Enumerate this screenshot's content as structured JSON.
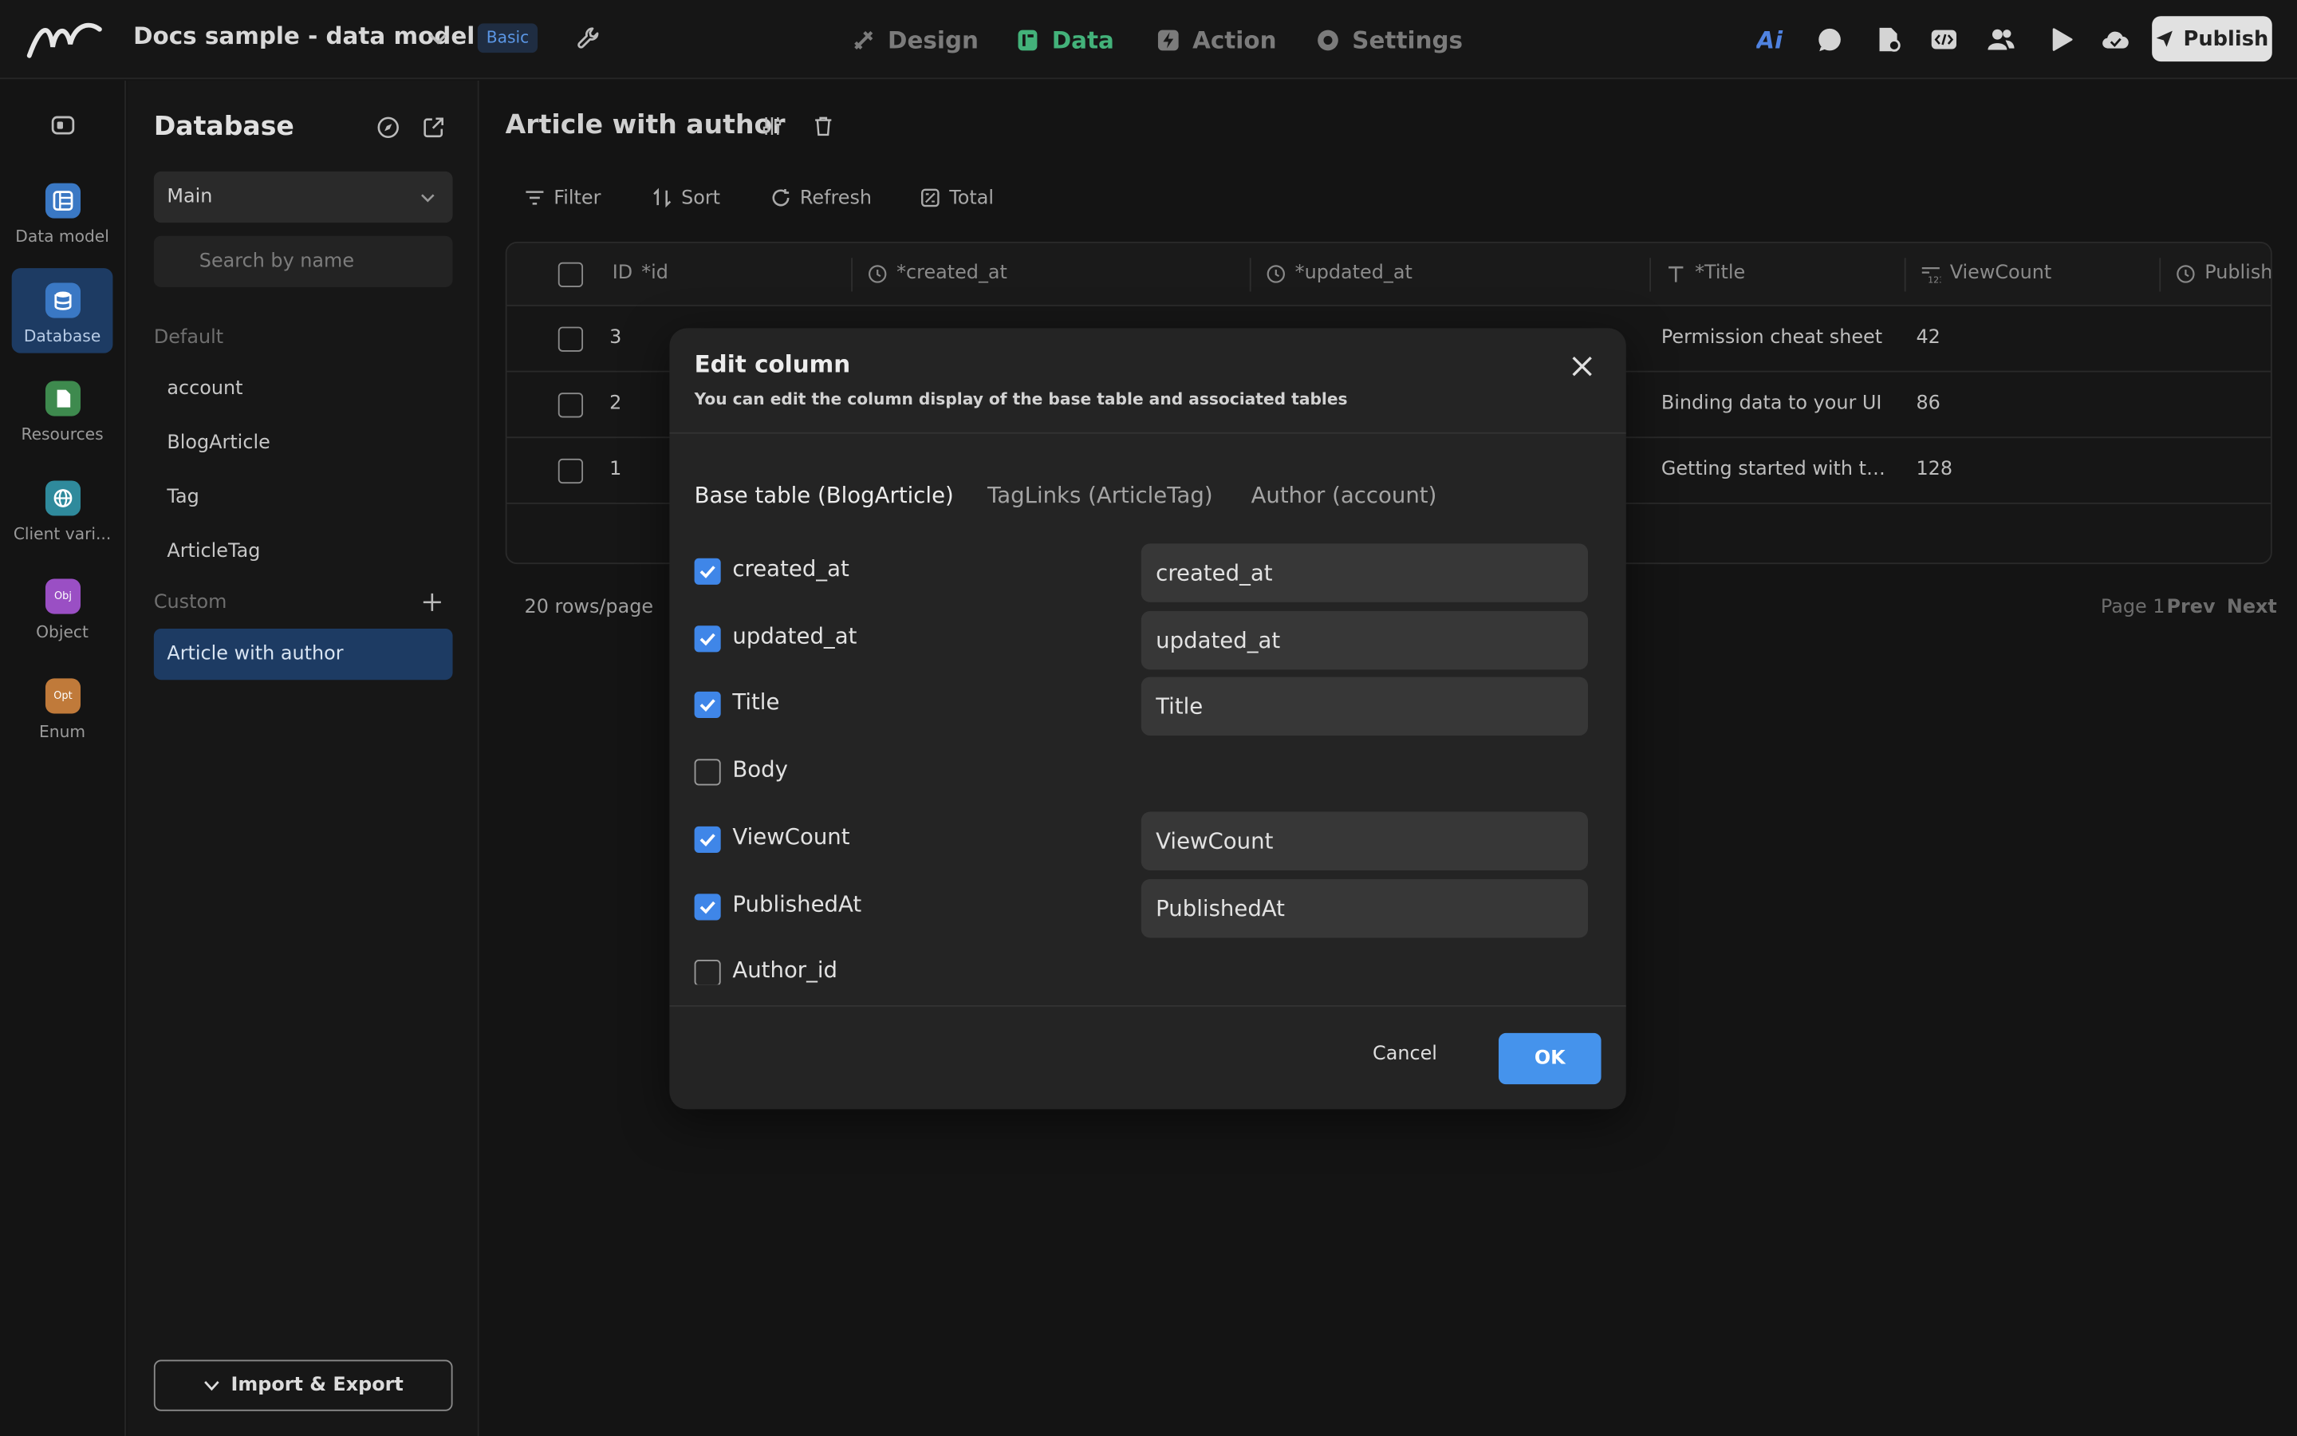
{
  "app": {
    "title": "Docs sample - data model",
    "plan_badge": "Basic",
    "nav_tabs": [
      {
        "label": "Design",
        "active": false
      },
      {
        "label": "Data",
        "active": true
      },
      {
        "label": "Action",
        "active": false
      },
      {
        "label": "Settings",
        "active": false
      }
    ],
    "right_icons": [
      "ai-icon",
      "chat-icon",
      "file-icon",
      "code-icon",
      "users-icon",
      "play-icon",
      "cloud-icon"
    ],
    "publish_label": "Publish",
    "colors": {
      "accent": "#4593ec",
      "data_tab": "#43b27a",
      "selected_bg": "#1d3b63"
    }
  },
  "rail": {
    "items": [
      {
        "label": "Data model",
        "icon": "data-model-icon",
        "color": "#3a78c4",
        "active": false
      },
      {
        "label": "Database",
        "icon": "database-icon",
        "color": "#3a78c4",
        "active": true
      },
      {
        "label": "Resources",
        "icon": "resources-icon",
        "color": "#3e8a4e",
        "active": false
      },
      {
        "label": "Client vari...",
        "icon": "globe-icon",
        "color": "#2f8a9c",
        "active": false
      },
      {
        "label": "Object",
        "icon": "object-icon",
        "color": "#9a4fc4",
        "glyph": "Obj",
        "active": false
      },
      {
        "label": "Enum",
        "icon": "enum-icon",
        "color": "#c07a3a",
        "glyph": "Opt",
        "active": false
      }
    ]
  },
  "database_panel": {
    "title": "Database",
    "branch": "Main",
    "search_placeholder": "Search by name",
    "default_section": "Default",
    "default_items": [
      "account",
      "BlogArticle",
      "Tag",
      "ArticleTag"
    ],
    "custom_section": "Custom",
    "custom_items": [
      "Article with author"
    ],
    "import_export_label": "Import & Export"
  },
  "main": {
    "title": "Article with author",
    "toolbar": {
      "filter": "Filter",
      "sort": "Sort",
      "refresh": "Refresh",
      "total": "Total"
    },
    "columns": [
      {
        "label": "ID",
        "req": "*id"
      },
      {
        "label": "*created_at"
      },
      {
        "label": "*updated_at"
      },
      {
        "label": "*Title"
      },
      {
        "label": "ViewCount"
      },
      {
        "label": "Publish"
      }
    ],
    "rows": [
      {
        "id": "3",
        "title": "Permission cheat sheet",
        "views": "42"
      },
      {
        "id": "2",
        "title": "Binding data to your UI",
        "views": "86"
      },
      {
        "id": "1",
        "title": "Getting started with the ...",
        "views": "128"
      }
    ],
    "page_size": "20 rows/page",
    "page_label": "Page 1",
    "prev": "Prev",
    "next": "Next"
  },
  "modal": {
    "title": "Edit column",
    "subtitle": "You can edit the column display of the base table and associated tables",
    "tabs": [
      {
        "label": "Base table (BlogArticle)",
        "active": true
      },
      {
        "label": "TagLinks (ArticleTag)",
        "active": false
      },
      {
        "label": "Author (account)",
        "active": false
      }
    ],
    "columns": [
      {
        "name": "created_at",
        "checked": true,
        "display": "created_at"
      },
      {
        "name": "updated_at",
        "checked": true,
        "display": "updated_at"
      },
      {
        "name": "Title",
        "checked": true,
        "display": "Title"
      },
      {
        "name": "Body",
        "checked": false,
        "display": ""
      },
      {
        "name": "ViewCount",
        "checked": true,
        "display": "ViewCount"
      },
      {
        "name": "PublishedAt",
        "checked": true,
        "display": "PublishedAt"
      },
      {
        "name": "Author_id",
        "checked": false,
        "display": ""
      }
    ],
    "cancel_label": "Cancel",
    "ok_label": "OK"
  }
}
